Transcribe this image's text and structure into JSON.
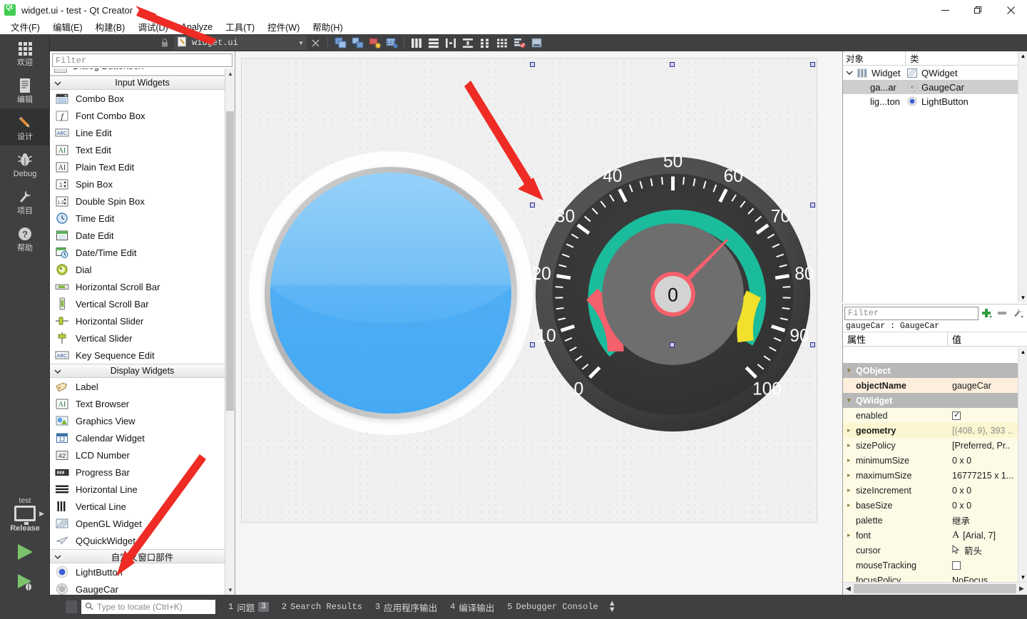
{
  "window": {
    "title": "widget.ui - test - Qt Creator",
    "logo_icon": "qt-logo-icon",
    "controls": [
      {
        "name": "minimize-button",
        "glyph": "—"
      },
      {
        "name": "maximize-button",
        "glyph": "❐"
      },
      {
        "name": "close-button",
        "glyph": "✕"
      }
    ]
  },
  "menubar": {
    "items": [
      {
        "label": "文件(F)",
        "name": "menu-file"
      },
      {
        "label": "编辑(E)",
        "name": "menu-edit"
      },
      {
        "label": "构建(B)",
        "name": "menu-build"
      },
      {
        "label": "调试(D)",
        "name": "menu-debug"
      },
      {
        "label": "Analyze",
        "name": "menu-analyze"
      },
      {
        "label": "工具(T)",
        "name": "menu-tools"
      },
      {
        "label": "控件(W)",
        "name": "menu-window"
      },
      {
        "label": "帮助(H)",
        "name": "menu-help"
      }
    ]
  },
  "modebar": {
    "items": [
      {
        "label": "欢迎",
        "icon": "grid-icon",
        "active": false
      },
      {
        "label": "编辑",
        "icon": "document-icon",
        "active": false
      },
      {
        "label": "设计",
        "icon": "pencil-icon",
        "active": true
      },
      {
        "label": "Debug",
        "icon": "bug-icon",
        "active": false
      },
      {
        "label": "项目",
        "icon": "wrench-icon",
        "active": false
      },
      {
        "label": "帮助",
        "icon": "question-icon",
        "active": false
      }
    ],
    "kit": {
      "project": "test",
      "build_config": "Release",
      "monitor_icon": "desktop-icon",
      "run_icon": "run-play-icon",
      "debug_icon": "debug-play-icon",
      "build_icon": "hammer-icon"
    }
  },
  "editor_toolbar": {
    "lock_icon": "lock-icon",
    "document_name": "widget.ui",
    "document_icon": "ui-file-icon",
    "dropdown_caret": "chevron-down-icon",
    "close_label": "✕",
    "buttons": [
      {
        "name": "edit-widgets-button",
        "icon": "edit-widgets-icon"
      },
      {
        "name": "edit-signals-slots-button",
        "icon": "signals-slots-icon"
      },
      {
        "name": "edit-buddies-button",
        "icon": "buddies-icon"
      },
      {
        "name": "edit-tab-order-button",
        "icon": "tab-order-icon"
      },
      {
        "name": "layout-horizontally-button",
        "icon": "layout-horizontal-icon"
      },
      {
        "name": "layout-vertically-button",
        "icon": "layout-vertical-icon"
      },
      {
        "name": "layout-splitter-horizontal-button",
        "icon": "splitter-horizontal-icon"
      },
      {
        "name": "layout-splitter-vertical-button",
        "icon": "splitter-vertical-icon"
      },
      {
        "name": "layout-form-button",
        "icon": "layout-form-icon"
      },
      {
        "name": "layout-grid-button",
        "icon": "layout-grid-icon"
      },
      {
        "name": "break-layout-button",
        "icon": "break-layout-icon"
      },
      {
        "name": "adjust-size-button",
        "icon": "adjust-size-icon"
      }
    ]
  },
  "widget_box": {
    "filter_placeholder": "Filter",
    "groups": [
      {
        "name": "Input Widgets",
        "items": [
          {
            "label": "Combo Box",
            "icon": "combo-box-icon"
          },
          {
            "label": "Font Combo Box",
            "icon": "font-combo-box-icon"
          },
          {
            "label": "Line Edit",
            "icon": "line-edit-icon"
          },
          {
            "label": "Text Edit",
            "icon": "text-edit-icon"
          },
          {
            "label": "Plain Text Edit",
            "icon": "plain-text-edit-icon"
          },
          {
            "label": "Spin Box",
            "icon": "spin-box-icon"
          },
          {
            "label": "Double Spin Box",
            "icon": "double-spin-box-icon"
          },
          {
            "label": "Time Edit",
            "icon": "time-edit-icon"
          },
          {
            "label": "Date Edit",
            "icon": "date-edit-icon"
          },
          {
            "label": "Date/Time Edit",
            "icon": "date-time-edit-icon"
          },
          {
            "label": "Dial",
            "icon": "dial-icon"
          },
          {
            "label": "Horizontal Scroll Bar",
            "icon": "horizontal-scroll-bar-icon"
          },
          {
            "label": "Vertical Scroll Bar",
            "icon": "vertical-scroll-bar-icon"
          },
          {
            "label": "Horizontal Slider",
            "icon": "horizontal-slider-icon"
          },
          {
            "label": "Vertical Slider",
            "icon": "vertical-slider-icon"
          },
          {
            "label": "Key Sequence Edit",
            "icon": "key-sequence-edit-icon"
          }
        ]
      },
      {
        "name": "Display Widgets",
        "items": [
          {
            "label": "Label",
            "icon": "label-icon"
          },
          {
            "label": "Text Browser",
            "icon": "text-browser-icon"
          },
          {
            "label": "Graphics View",
            "icon": "graphics-view-icon"
          },
          {
            "label": "Calendar Widget",
            "icon": "calendar-widget-icon"
          },
          {
            "label": "LCD Number",
            "icon": "lcd-number-icon"
          },
          {
            "label": "Progress Bar",
            "icon": "progress-bar-icon"
          },
          {
            "label": "Horizontal Line",
            "icon": "horizontal-line-icon"
          },
          {
            "label": "Vertical Line",
            "icon": "vertical-line-icon"
          },
          {
            "label": "OpenGL Widget",
            "icon": "opengl-widget-icon"
          },
          {
            "label": "QQuickWidget",
            "icon": "qquickwidget-icon"
          }
        ]
      },
      {
        "name": "自定义窗口部件",
        "items": [
          {
            "label": "LightButton",
            "icon": "lightbutton-icon"
          },
          {
            "label": "GaugeCar",
            "icon": "gaugecar-icon"
          }
        ]
      }
    ]
  },
  "canvas": {
    "light_button": {
      "name": "lightButton",
      "color": "#4eaef5"
    },
    "gauge": {
      "name": "gaugeCar",
      "value": "0",
      "min": 0,
      "max": 100,
      "tick_labels": [
        "0",
        "10",
        "20",
        "30",
        "40",
        "50",
        "60",
        "70",
        "80",
        "90",
        "100"
      ],
      "band_colors": {
        "safe": "#1abc9c",
        "warning": "#f1e12a",
        "danger": "#f4606c"
      },
      "needle_color": "#f4606c",
      "dial_background": "#3a3a3a",
      "bezel_color": "#4a4a4a"
    }
  },
  "object_inspector": {
    "columns": [
      "对象",
      "类"
    ],
    "rows": [
      {
        "object": "Widget",
        "class": "QWidget",
        "icon": "qwidget-icon",
        "selected": false,
        "expander": "chevron-down-icon",
        "indent": 0
      },
      {
        "object": "ga...ar",
        "class": "GaugeCar",
        "icon": "gaugecar-icon",
        "selected": true,
        "expander": "",
        "indent": 1
      },
      {
        "object": "lig...ton",
        "class": "LightButton",
        "icon": "lightbutton-icon",
        "selected": false,
        "expander": "",
        "indent": 1
      }
    ]
  },
  "property_editor": {
    "filter_placeholder": "Filter",
    "toolbar": [
      {
        "name": "add-dynamic-property-button",
        "icon": "plus-icon"
      },
      {
        "name": "remove-dynamic-property-button",
        "icon": "minus-icon"
      },
      {
        "name": "configure-property-editor-button",
        "icon": "wrench-icon"
      }
    ],
    "object_line": "gaugeCar : GaugeCar",
    "columns": [
      "属性",
      "值"
    ],
    "rows": [
      {
        "type": "group",
        "key": "QObject",
        "value": "",
        "expander": "chevron-down-icon"
      },
      {
        "type": "prop",
        "key": "objectName",
        "value": "gaugeCar",
        "bold": true,
        "shade": "alt1",
        "expander": ""
      },
      {
        "type": "group",
        "key": "QWidget",
        "value": "",
        "expander": "chevron-down-icon"
      },
      {
        "type": "prop",
        "key": "enabled",
        "value": "",
        "control": "checkbox-checked",
        "shade": "alt3",
        "expander": ""
      },
      {
        "type": "prop",
        "key": "geometry",
        "value": "[(408, 9), 393 ..",
        "bold": true,
        "shade": "alt2",
        "expander": "chevron-right-icon"
      },
      {
        "type": "prop",
        "key": "sizePolicy",
        "value": "[Preferred, Pr..",
        "shade": "alt3",
        "expander": "chevron-right-icon"
      },
      {
        "type": "prop",
        "key": "minimumSize",
        "value": "0 x 0",
        "shade": "alt3",
        "expander": "chevron-right-icon"
      },
      {
        "type": "prop",
        "key": "maximumSize",
        "value": "16777215 x 1...",
        "shade": "alt3",
        "expander": "chevron-right-icon"
      },
      {
        "type": "prop",
        "key": "sizeIncrement",
        "value": "0 x 0",
        "shade": "alt3",
        "expander": "chevron-right-icon"
      },
      {
        "type": "prop",
        "key": "baseSize",
        "value": "0 x 0",
        "shade": "alt3",
        "expander": "chevron-right-icon"
      },
      {
        "type": "prop",
        "key": "palette",
        "value": "继承",
        "shade": "alt3",
        "expander": ""
      },
      {
        "type": "prop",
        "key": "font",
        "value": "[Arial, 7]",
        "control": "font-icon",
        "shade": "alt3",
        "expander": "chevron-right-icon"
      },
      {
        "type": "prop",
        "key": "cursor",
        "value": "箭头",
        "control": "cursor-icon",
        "shade": "alt3",
        "expander": ""
      },
      {
        "type": "prop",
        "key": "mouseTracking",
        "value": "",
        "control": "checkbox-unchecked",
        "shade": "alt3",
        "expander": ""
      },
      {
        "type": "prop",
        "key": "focusPolicy",
        "value": "NoFocus",
        "shade": "alt3",
        "expander": ""
      }
    ]
  },
  "statusbar": {
    "toggle_sidebar_name": "toggle-output-pane-button",
    "locator_placeholder": "Type to locate (Ctrl+K)",
    "locator_icon": "search-icon",
    "panes": [
      {
        "num": "1",
        "label": "问题",
        "badge": "3",
        "cjk": true
      },
      {
        "num": "2",
        "label": "Search Results",
        "badge": "",
        "cjk": false
      },
      {
        "num": "3",
        "label": "应用程序输出",
        "badge": "",
        "cjk": true
      },
      {
        "num": "4",
        "label": "编译输出",
        "badge": "",
        "cjk": true
      },
      {
        "num": "5",
        "label": "Debugger Console",
        "badge": "",
        "cjk": false
      }
    ]
  }
}
